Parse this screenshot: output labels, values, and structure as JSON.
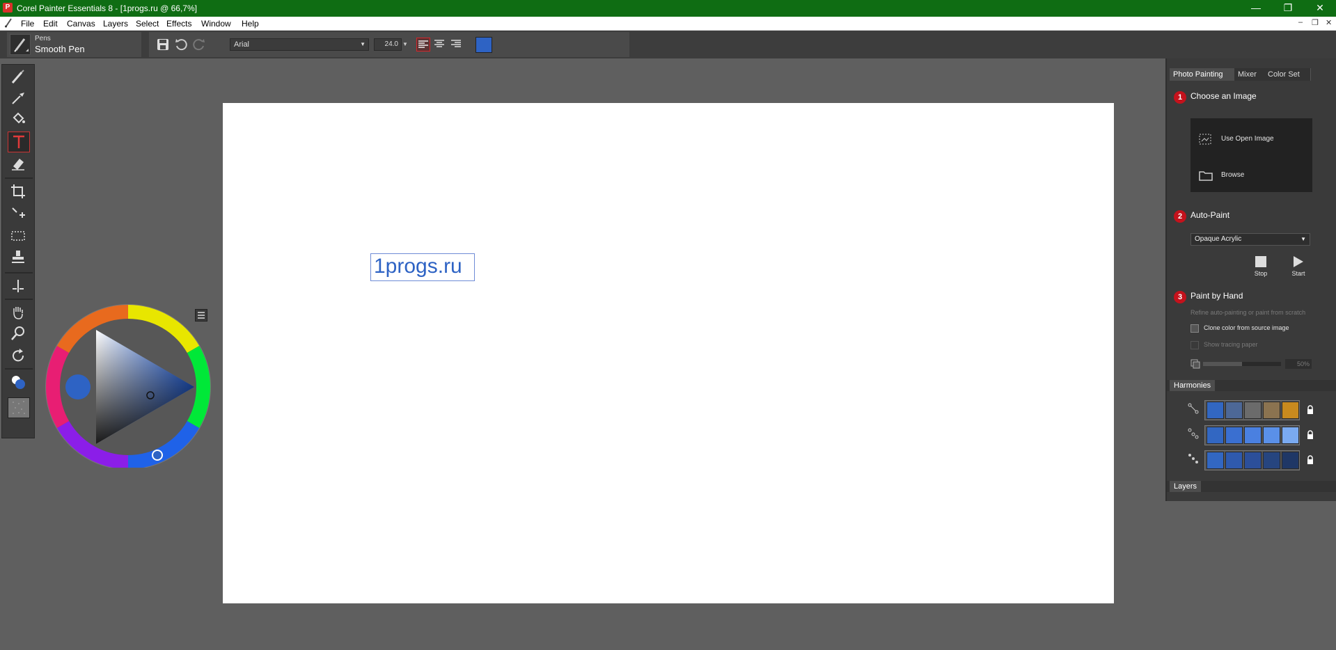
{
  "window": {
    "title": "Corel Painter Essentials 8 - [1progs.ru @ 66,7%]",
    "app_icon": "P"
  },
  "menu": [
    "File",
    "Edit",
    "Canvas",
    "Layers",
    "Select",
    "Effects",
    "Window",
    "Help"
  ],
  "brush": {
    "category": "Pens",
    "variant": "Smooth Pen"
  },
  "text_tool": {
    "font": "Arial",
    "size": "24.0",
    "color": "#2e63c4"
  },
  "canvas": {
    "text": "1progs.ru",
    "text_color": "#2e63c4"
  },
  "color_wheel": {
    "current_color": "#2e63c4"
  },
  "right_panel": {
    "tabs": [
      "Photo Painting",
      "Mixer",
      "Color Set"
    ],
    "step1": {
      "num": "1",
      "title": "Choose an Image",
      "use_open": "Use Open Image",
      "browse": "Browse"
    },
    "step2": {
      "num": "2",
      "title": "Auto-Paint",
      "style": "Opaque Acrylic",
      "stop": "Stop",
      "start": "Start"
    },
    "step3": {
      "num": "3",
      "title": "Paint by Hand",
      "desc": "Refine auto-painting or paint from scratch",
      "clone_color": "Clone color from source image",
      "show_tracing": "Show tracing paper",
      "opacity": "50%"
    },
    "harmonies": {
      "title": "Harmonies",
      "rows": [
        {
          "icon": "harmony-complementary-icon",
          "colors": [
            "#3267c2",
            "#4d6897",
            "#6b6b6b",
            "#8b7350",
            "#c88a1e"
          ]
        },
        {
          "icon": "harmony-analogous-icon",
          "colors": [
            "#3267c2",
            "#3a6fd0",
            "#4a80e0",
            "#5a90e8",
            "#7aaaf0"
          ]
        },
        {
          "icon": "harmony-monochrome-icon",
          "colors": [
            "#3267c2",
            "#2f5aae",
            "#2c4f9a",
            "#26457f",
            "#1f3766"
          ]
        }
      ]
    },
    "layers_title": "Layers"
  }
}
